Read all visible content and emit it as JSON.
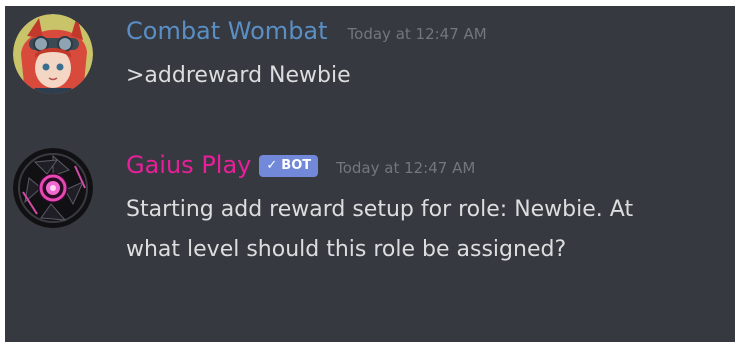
{
  "messages": [
    {
      "username": "Combat Wombat",
      "username_color": "#5a8fc5",
      "timestamp": "Today at 12:47 AM",
      "text": ">addreward Newbie",
      "avatar_icon": "anime-avatar-icon"
    },
    {
      "username": "Gaius Play",
      "username_color": "#e91e9a",
      "bot_badge": "BOT",
      "bot_badge_icon": "checkmark-icon",
      "bot_badge_color": "#7289da",
      "timestamp": "Today at 12:47 AM",
      "text": "Starting add reward setup for role: Newbie. At what level should this role be assigned?",
      "avatar_icon": "camera-aperture-icon"
    }
  ],
  "colors": {
    "background": "#36393f",
    "text": "#dcddde",
    "timestamp": "#72767d"
  }
}
